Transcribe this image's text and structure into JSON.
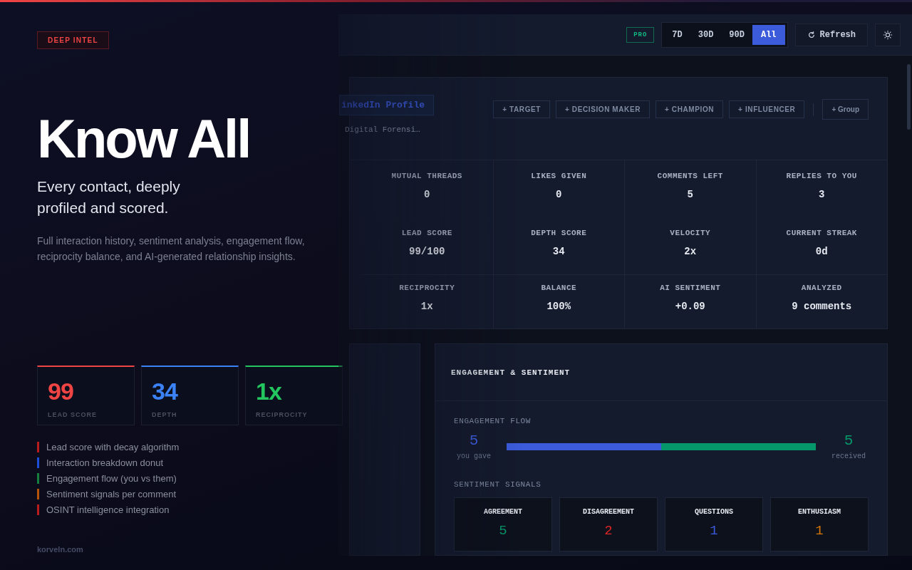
{
  "hero": {
    "badge": "DEEP INTEL",
    "headline": "Know All",
    "subhead": "Every contact, deeply profiled and scored.",
    "description": "Full interaction history, sentiment analysis, engagement flow, reciprocity balance, and AI-generated relationship insights.",
    "score_cards": [
      {
        "value": "99",
        "label": "LEAD SCORE",
        "color": "#ef4444"
      },
      {
        "value": "34",
        "label": "DEPTH",
        "color": "#3b82f6"
      },
      {
        "value": "1x",
        "label": "RECIPROCITY",
        "color": "#22c55e"
      }
    ],
    "features": [
      {
        "text": "Lead score with decay algorithm",
        "color": "#b91c1c"
      },
      {
        "text": "Interaction breakdown donut",
        "color": "#1d4ed8"
      },
      {
        "text": "Engagement flow (you vs them)",
        "color": "#15803d"
      },
      {
        "text": "Sentiment signals per comment",
        "color": "#b45309"
      },
      {
        "text": "OSINT intelligence integration",
        "color": "#b91c1c"
      }
    ],
    "footer": "korveln.com"
  },
  "dashboard": {
    "plan_badge": "PRO",
    "ranges": [
      {
        "label": "7D",
        "selected": false
      },
      {
        "label": "30D",
        "selected": false
      },
      {
        "label": "90D",
        "selected": false
      },
      {
        "label": "All",
        "selected": true
      }
    ],
    "refresh_button": "Refresh",
    "profile_link": "inkedIn Profile",
    "profile_subtitle": "Digital Forensi…",
    "tags": [
      "+ TARGET",
      "+ DECISION MAKER",
      "+ CHAMPION",
      "+ INFLUENCER"
    ],
    "group_button": "+ Group",
    "stats": [
      {
        "label": "MUTUAL THREADS",
        "value": "0"
      },
      {
        "label": "LIKES GIVEN",
        "value": "0"
      },
      {
        "label": "COMMENTS LEFT",
        "value": "5"
      },
      {
        "label": "REPLIES TO YOU",
        "value": "3"
      },
      {
        "label": "LEAD SCORE",
        "value": "99/100"
      },
      {
        "label": "DEPTH SCORE",
        "value": "34"
      },
      {
        "label": "VELOCITY",
        "value": "2x"
      },
      {
        "label": "CURRENT STREAK",
        "value": "0d"
      },
      {
        "label": "RECIPROCITY",
        "value": "1x"
      },
      {
        "label": "BALANCE",
        "value": "100%"
      },
      {
        "label": "AI SENTIMENT",
        "value": "+0.09"
      },
      {
        "label": "ANALYZED",
        "value": "9 comments"
      }
    ],
    "engagement": {
      "title": "ENGAGEMENT & SENTIMENT",
      "flow_title": "ENGAGEMENT FLOW",
      "gave": {
        "value": "5",
        "label": "you gave"
      },
      "received": {
        "value": "5",
        "label": "received"
      },
      "level": 0.5,
      "signals_title": "SENTIMENT SIGNALS",
      "signals": [
        {
          "label": "AGREEMENT",
          "value": "5",
          "color": "#059669"
        },
        {
          "label": "DISAGREEMENT",
          "value": "2",
          "color": "#dc2626"
        },
        {
          "label": "QUESTIONS",
          "value": "1",
          "color": "#3b5bdb"
        },
        {
          "label": "ENTHUSIASM",
          "value": "1",
          "color": "#d97706"
        }
      ]
    }
  }
}
